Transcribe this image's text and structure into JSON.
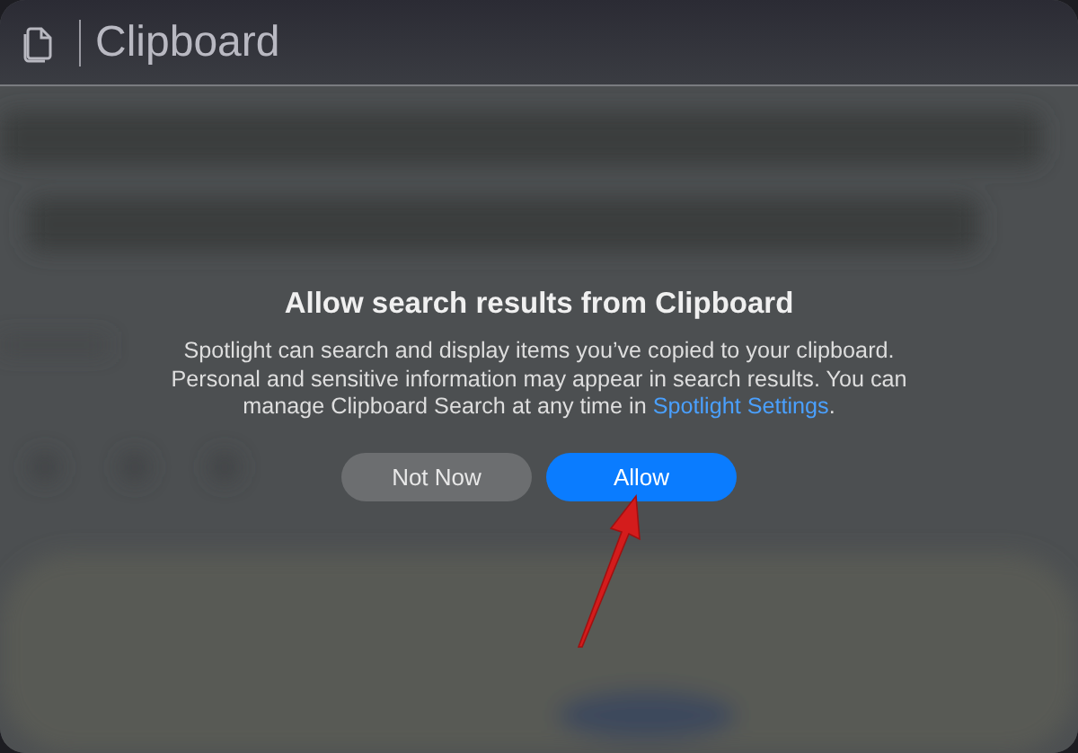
{
  "search": {
    "value": "Clipboard"
  },
  "dialog": {
    "title": "Allow search results from Clipboard",
    "message": {
      "before": "Spotlight can search and display items you’ve copied to your clipboard. Personal and sensitive information may appear in search results. You can manage Clipboard Search at any time in ",
      "link": "Spotlight Settings",
      "after": "."
    },
    "buttons": [
      {
        "label": "Not Now",
        "kind": "secondary"
      },
      {
        "label": "Allow",
        "kind": "primary"
      }
    ]
  }
}
